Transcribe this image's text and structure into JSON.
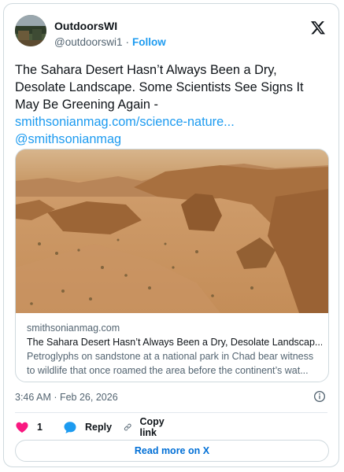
{
  "author": {
    "name": "OutdoorsWI",
    "handle": "@outdoorswi1",
    "separator": "·",
    "follow_label": "Follow"
  },
  "tweet": {
    "text_lines": [
      "The Sahara Desert Hasn’t Always Been a Dry,",
      "Desolate Landscape. Some Scientists See Signs It",
      "May Be Greening Again -"
    ],
    "link_text": "smithsonianmag.com/science-nature...",
    "mention": "@smithsonianmag"
  },
  "link_card": {
    "domain": "smithsonianmag.com",
    "title": "The Sahara Desert Hasn’t Always Been a Dry, Desolate Landscap...",
    "description": "Petroglyphs on sandstone at a national park in Chad bear witness to wildlife that once roamed the area before the continent’s wat..."
  },
  "timestamp": "3:46 AM · Feb 26, 2026",
  "actions": {
    "like_count": "1",
    "reply_label": "Reply",
    "copy_label": "Copy link"
  },
  "read_more_label": "Read more on X",
  "colors": {
    "accent": "#1d9bf0",
    "like": "#f91880",
    "border": "#cfd9de",
    "muted": "#536471"
  },
  "icons": [
    "x-logo-icon",
    "info-icon",
    "heart-icon",
    "reply-bubble-icon",
    "link-icon"
  ]
}
